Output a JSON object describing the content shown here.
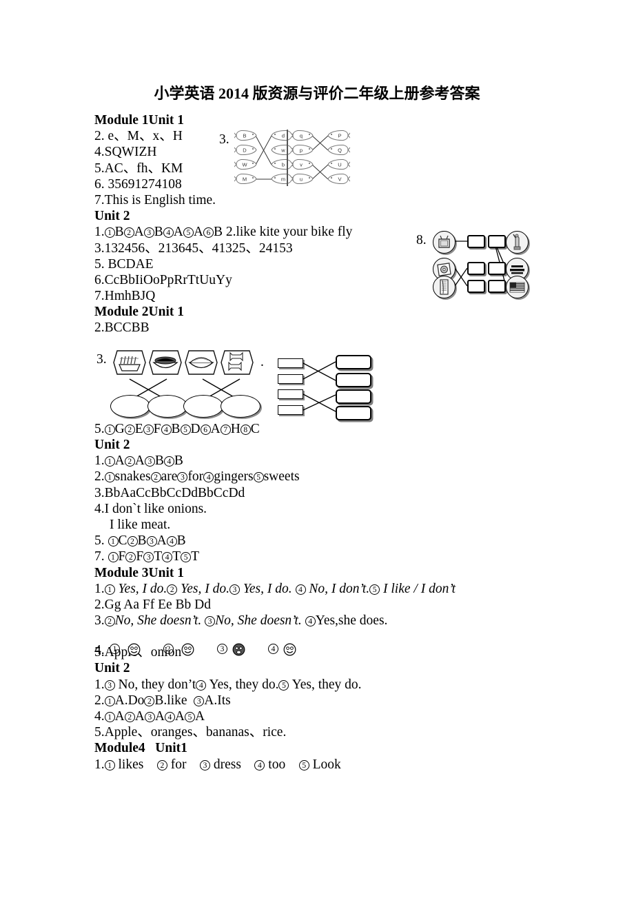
{
  "document": {
    "title": "小学英语 2014 版资源与评价二年级上册参考答案"
  },
  "sections": {
    "m1u1_heading": "Module 1Unit 1",
    "m1u1_l2": "2. e、M、x、H",
    "m1u1_l4": "4.SQWIZH",
    "m1u1_l5": "5.AC、fh、KM",
    "m1u1_l6": "6. 35691274108",
    "m1u1_l7": "7.This is English time.",
    "m1u2_heading": "Unit 2",
    "m1u2_l3": "3.132456、213645、41325、24153",
    "m1u2_l5": "5. BCDAE",
    "m1u2_l6": "6.CcBbIiOoPpRrTtUuYy",
    "m1u2_l7": "7.HmhBJQ",
    "m2u1_heading": "Module 2Unit 1",
    "m2u1_l2": "2.BCCBB",
    "m2u2_heading": "Unit 2",
    "m2u2_l3": "3.BbAaCcBbCcDdBbCcDd",
    "m2u2_l4a": "4.I don`t like onions.",
    "m2u2_l4b": "I like meat.",
    "m3u1_heading": "Module 3Unit 1",
    "m3u1_l2": "2.Gg Aa Ff Ee Bb Dd",
    "m3u1_l5": "5.Apple、onion",
    "m3u2_heading": "Unit 2",
    "m3u2_l5": "5.Apple、oranges、bananas、rice.",
    "m4u1_heading": "Module4   Unit1"
  },
  "numbered_answers": {
    "m1u2_q1": {
      "prefix": "1.",
      "items": [
        {
          "num": "1",
          "answer": "B"
        },
        {
          "num": "2",
          "answer": "A"
        },
        {
          "num": "3",
          "answer": "B"
        },
        {
          "num": "4",
          "answer": "A"
        },
        {
          "num": "5",
          "answer": "A"
        },
        {
          "num": "6",
          "answer": "B"
        }
      ],
      "tail": " 2.like kite your bike fly"
    },
    "m2u1_q5": {
      "prefix": "5.",
      "items": [
        {
          "num": "1",
          "answer": "G"
        },
        {
          "num": "2",
          "answer": "E"
        },
        {
          "num": "3",
          "answer": "F"
        },
        {
          "num": "4",
          "answer": "B"
        },
        {
          "num": "5",
          "answer": "D"
        },
        {
          "num": "6",
          "answer": "A"
        },
        {
          "num": "7",
          "answer": "H"
        },
        {
          "num": "8",
          "answer": "C"
        }
      ],
      "tail": ""
    },
    "m2u2_q1": {
      "prefix": "1.",
      "items": [
        {
          "num": "1",
          "answer": "A"
        },
        {
          "num": "2",
          "answer": "A"
        },
        {
          "num": "3",
          "answer": "B"
        },
        {
          "num": "4",
          "answer": "B"
        }
      ],
      "tail": ""
    },
    "m2u2_q2": {
      "prefix": "2.",
      "items": [
        {
          "num": "1",
          "answer": "snakes"
        },
        {
          "num": "2",
          "answer": "are"
        },
        {
          "num": "3",
          "answer": "for"
        },
        {
          "num": "4",
          "answer": "gingers"
        },
        {
          "num": "5",
          "answer": "sweets"
        }
      ],
      "tail": ""
    },
    "m2u2_q5": {
      "prefix": "5. ",
      "items": [
        {
          "num": "1",
          "answer": "C"
        },
        {
          "num": "2",
          "answer": "B"
        },
        {
          "num": "3",
          "answer": "A"
        },
        {
          "num": "4",
          "answer": "B"
        }
      ],
      "tail": ""
    },
    "m2u2_q7": {
      "prefix": "7. ",
      "items": [
        {
          "num": "1",
          "answer": "F"
        },
        {
          "num": "2",
          "answer": "F"
        },
        {
          "num": "3",
          "answer": "T"
        },
        {
          "num": "4",
          "answer": "T"
        },
        {
          "num": "5",
          "answer": "T"
        }
      ],
      "tail": ""
    },
    "m3u1_q1": {
      "prefix": "1.",
      "italic": true,
      "items": [
        {
          "num": "1",
          "answer": " Yes, I do."
        },
        {
          "num": "2",
          "answer": " Yes, I do."
        },
        {
          "num": "3",
          "answer": " Yes, I do. "
        },
        {
          "num": "4",
          "answer": " No, I don’t."
        },
        {
          "num": "5",
          "answer": " I like / I don’t"
        }
      ],
      "tail": ""
    },
    "m3u1_q3": {
      "prefix": "3.",
      "italic": true,
      "items": [
        {
          "num": "2",
          "answer": "No, She doesn’t. "
        },
        {
          "num": "3",
          "answer": "No, She doesn’t. "
        },
        {
          "num": "4",
          "answer": "Yes,she does.",
          "roman": true
        }
      ],
      "tail": ""
    },
    "m3u2_q1": {
      "prefix": "1.",
      "items": [
        {
          "num": "3",
          "answer": " No, they don’t"
        },
        {
          "num": "4",
          "answer": " Yes, they do."
        },
        {
          "num": "5",
          "answer": " Yes, they do."
        }
      ],
      "tail": ""
    },
    "m3u2_q2": {
      "prefix": "2.",
      "items": [
        {
          "num": "1",
          "answer": "A.Do"
        },
        {
          "num": "2",
          "answer": "B.like  "
        },
        {
          "num": "3",
          "answer": "A.Its"
        }
      ],
      "tail": ""
    },
    "m3u2_q4": {
      "prefix": "4.",
      "items": [
        {
          "num": "1",
          "answer": "A"
        },
        {
          "num": "2",
          "answer": "A"
        },
        {
          "num": "3",
          "answer": "A"
        },
        {
          "num": "4",
          "answer": "A"
        },
        {
          "num": "5",
          "answer": "A"
        }
      ],
      "tail": ""
    },
    "m4u1_q1": {
      "prefix": "1.",
      "items": [
        {
          "num": "1",
          "answer": " likes    "
        },
        {
          "num": "2",
          "answer": " for    "
        },
        {
          "num": "3",
          "answer": " dress    "
        },
        {
          "num": "4",
          "answer": " too    "
        },
        {
          "num": "5",
          "answer": " Look"
        }
      ],
      "tail": ""
    }
  },
  "figures": {
    "fish_matching": {
      "label": "3.",
      "left_group": {
        "left_column": [
          "B",
          "D",
          "W",
          "M"
        ],
        "right_column": [
          "d",
          "w",
          "b",
          "m"
        ],
        "connections": [
          [
            0,
            2
          ],
          [
            2,
            0
          ],
          [
            3,
            3
          ]
        ]
      },
      "right_group": {
        "left_column": [
          "q",
          "p",
          "v",
          "u"
        ],
        "right_column": [
          "P",
          "Q",
          "U",
          "V"
        ],
        "connections": [
          [
            0,
            1
          ],
          [
            1,
            0
          ],
          [
            2,
            3
          ],
          [
            3,
            2
          ]
        ]
      }
    },
    "item8_matching": {
      "label": "8.",
      "left_icons": [
        "tv-icon",
        "cd-icon",
        "newspaper-icon"
      ],
      "right_icons": [
        "statue-of-liberty-icon",
        "sign-text-icon",
        "usa-flag-icon"
      ],
      "box_columns": 2,
      "box_rows": 3
    },
    "food_matching": {
      "label": "3.",
      "top_icons": [
        "dumplings-icon",
        "noodles-icon",
        "rice-bowl-icon",
        "sweets-icon"
      ],
      "bottom_shapes": 4,
      "trailing": "."
    },
    "box_matching": {
      "small_boxes": 4,
      "large_boxes": 4
    },
    "faces_row": {
      "label": "4.",
      "items": [
        {
          "num": "1",
          "face": "smiley-face-icon"
        },
        {
          "num": "2",
          "face": "smiley-face-icon"
        },
        {
          "num": "3",
          "face": "sad-face-icon"
        },
        {
          "num": "4",
          "face": "smiley-face-icon"
        }
      ]
    }
  }
}
